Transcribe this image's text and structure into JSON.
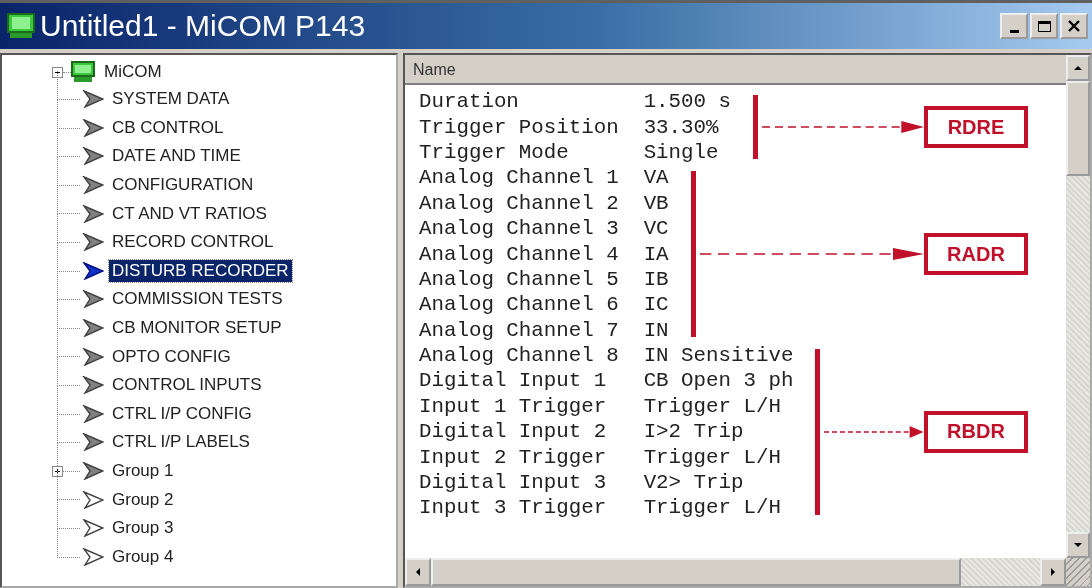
{
  "window": {
    "title": "Untitled1 - MiCOM P143"
  },
  "tree": {
    "label": "MiCOM",
    "expanded": true,
    "children": [
      {
        "label": "SYSTEM DATA",
        "kind": "filled",
        "selected": false
      },
      {
        "label": "CB CONTROL",
        "kind": "filled",
        "selected": false
      },
      {
        "label": "DATE AND TIME",
        "kind": "filled",
        "selected": false
      },
      {
        "label": "CONFIGURATION",
        "kind": "filled",
        "selected": false
      },
      {
        "label": "CT AND VT RATIOS",
        "kind": "filled",
        "selected": false
      },
      {
        "label": "RECORD CONTROL",
        "kind": "filled",
        "selected": false
      },
      {
        "label": "DISTURB RECORDER",
        "kind": "filled",
        "selected": true
      },
      {
        "label": "COMMISSION TESTS",
        "kind": "filled",
        "selected": false
      },
      {
        "label": "CB MONITOR SETUP",
        "kind": "filled",
        "selected": false
      },
      {
        "label": "OPTO CONFIG",
        "kind": "filled",
        "selected": false
      },
      {
        "label": "CONTROL INPUTS",
        "kind": "filled",
        "selected": false
      },
      {
        "label": "CTRL I/P CONFIG",
        "kind": "filled",
        "selected": false
      },
      {
        "label": "CTRL I/P LABELS",
        "kind": "filled",
        "selected": false
      },
      {
        "label": "Group 1",
        "kind": "filled",
        "selected": false,
        "expanded": false
      },
      {
        "label": "Group 2",
        "kind": "outline",
        "selected": false
      },
      {
        "label": "Group 3",
        "kind": "outline",
        "selected": false
      },
      {
        "label": "Group 4",
        "kind": "outline",
        "selected": false
      }
    ]
  },
  "list": {
    "header": "Name",
    "groups": [
      {
        "label": "RDRE",
        "rows": [
          {
            "name": "Duration",
            "value": "1.500 s"
          },
          {
            "name": "Trigger Position",
            "value": "33.30%"
          },
          {
            "name": "Trigger Mode",
            "value": "Single"
          }
        ]
      },
      {
        "label": "RADR",
        "rows": [
          {
            "name": "Analog Channel 1",
            "value": "VA"
          },
          {
            "name": "Analog Channel 2",
            "value": "VB"
          },
          {
            "name": "Analog Channel 3",
            "value": "VC"
          },
          {
            "name": "Analog Channel 4",
            "value": "IA"
          },
          {
            "name": "Analog Channel 5",
            "value": "IB"
          },
          {
            "name": "Analog Channel 6",
            "value": "IC"
          },
          {
            "name": "Analog Channel 7",
            "value": "IN"
          }
        ]
      },
      {
        "label": "RBDR",
        "rows": [
          {
            "name": "Analog Channel 8",
            "value": "IN Sensitive"
          },
          {
            "name": "Digital Input 1",
            "value": "CB Open 3 ph"
          },
          {
            "name": "Input 1 Trigger",
            "value": "Trigger L/H"
          },
          {
            "name": "Digital Input 2",
            "value": "I>2 Trip"
          },
          {
            "name": "Input 2 Trigger",
            "value": "Trigger L/H"
          },
          {
            "name": "Digital Input 3",
            "value": "V2> Trip"
          },
          {
            "name": "Input 3 Trigger",
            "value": "Trigger L/H"
          }
        ]
      }
    ]
  }
}
